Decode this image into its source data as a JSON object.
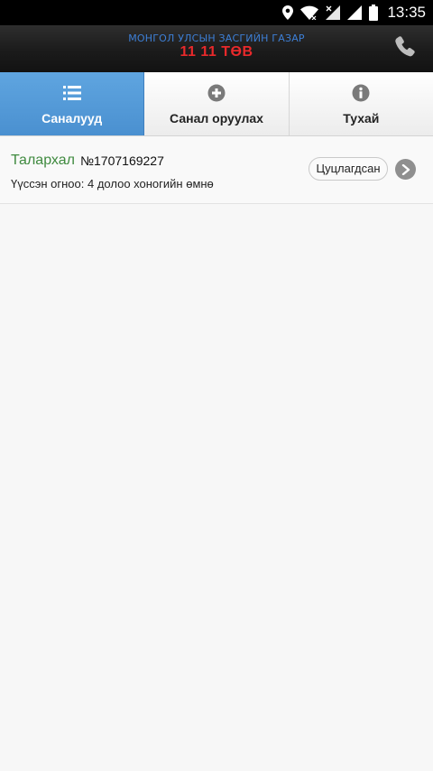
{
  "status_bar": {
    "time": "13:35",
    "icons": [
      "location-icon",
      "wifi-icon",
      "no-signal-icon",
      "signal-icon",
      "battery-icon"
    ]
  },
  "header": {
    "title_line1": "МОНГОЛ УЛСЫН ЗАСГИЙН ГАЗАР",
    "title_line2": "11 11 ТӨВ",
    "colors": {
      "line1": "#3d7fd6",
      "line2": "#e8292b"
    },
    "action_icon": "phone-icon"
  },
  "tabs": [
    {
      "label": "Саналууд",
      "icon": "list-icon",
      "active": true
    },
    {
      "label": "Санал оруулах",
      "icon": "plus-circle-icon",
      "active": false
    },
    {
      "label": "Тухай",
      "icon": "info-circle-icon",
      "active": false
    }
  ],
  "items": [
    {
      "category": "Талархал",
      "number": "№1707169227",
      "created": "Үүсcэн огноо: 4 долоо хоногийн өмнө",
      "status": "Цуцлагдсан",
      "status_color": "#3f8a3f"
    }
  ],
  "colors": {
    "accent": "#4a90d0",
    "background": "#f7f7f7"
  }
}
